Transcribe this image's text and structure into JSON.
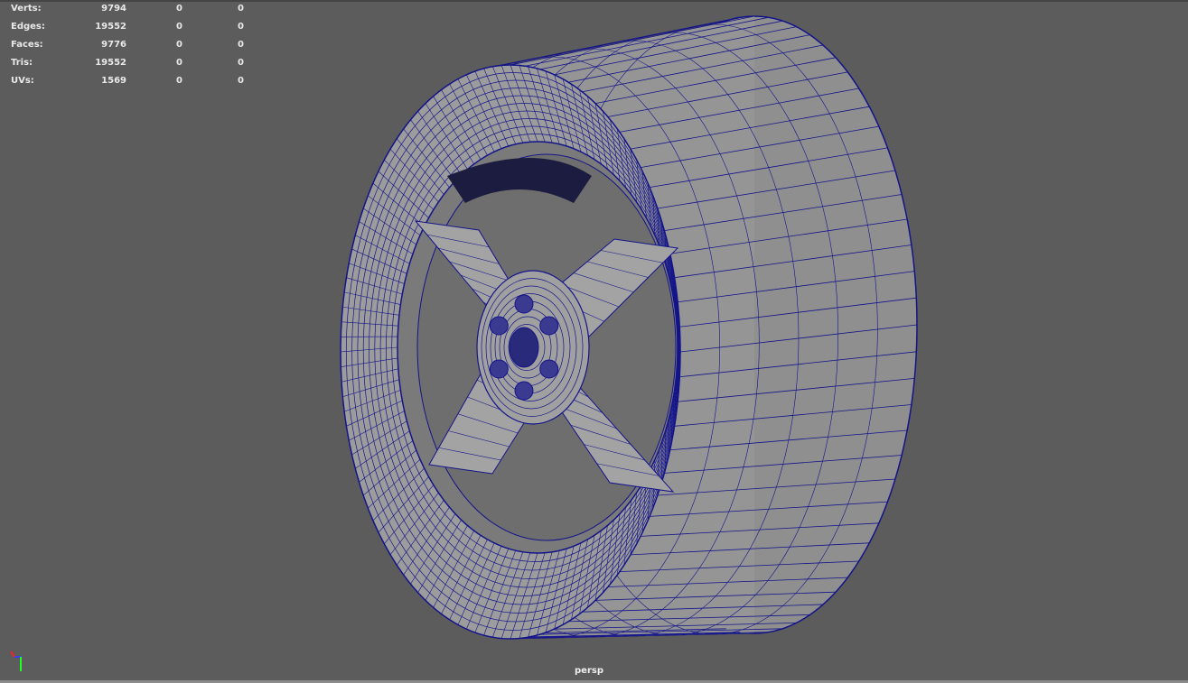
{
  "stats": [
    {
      "label": "Verts:",
      "values": [
        "9794",
        "0",
        "0"
      ]
    },
    {
      "label": "Edges:",
      "values": [
        "19552",
        "0",
        "0"
      ]
    },
    {
      "label": "Faces:",
      "values": [
        "9776",
        "0",
        "0"
      ]
    },
    {
      "label": "Tris:",
      "values": [
        "19552",
        "0",
        "0"
      ]
    },
    {
      "label": "UVs:",
      "values": [
        "1569",
        "0",
        "0"
      ]
    }
  ],
  "camera": "persp",
  "colors": {
    "background": "#5c5c5c",
    "mesh": "#9c9c9c",
    "wire": "#14148a"
  }
}
